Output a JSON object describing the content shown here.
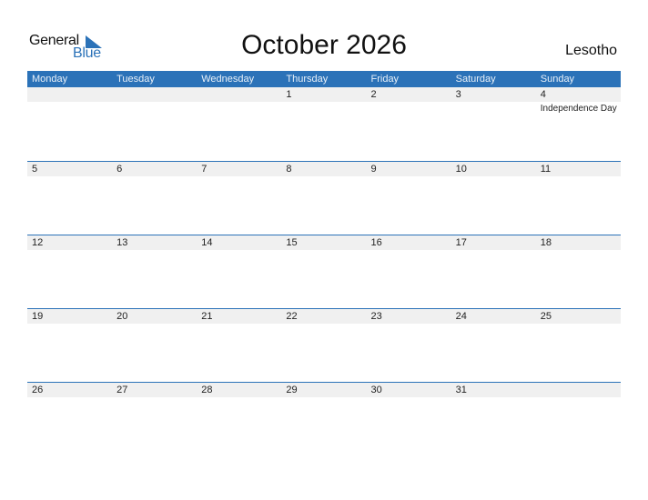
{
  "logo": {
    "line1": "General",
    "line2": "Blue",
    "icon": "triangle-flag-icon"
  },
  "title": "October 2026",
  "country": "Lesotho",
  "weekdays": [
    "Monday",
    "Tuesday",
    "Wednesday",
    "Thursday",
    "Friday",
    "Saturday",
    "Sunday"
  ],
  "weeks": [
    {
      "days": [
        "",
        "",
        "",
        "1",
        "2",
        "3",
        "4"
      ],
      "events": [
        "",
        "",
        "",
        "",
        "",
        "",
        "Independence Day"
      ]
    },
    {
      "days": [
        "5",
        "6",
        "7",
        "8",
        "9",
        "10",
        "11"
      ],
      "events": [
        "",
        "",
        "",
        "",
        "",
        "",
        ""
      ]
    },
    {
      "days": [
        "12",
        "13",
        "14",
        "15",
        "16",
        "17",
        "18"
      ],
      "events": [
        "",
        "",
        "",
        "",
        "",
        "",
        ""
      ]
    },
    {
      "days": [
        "19",
        "20",
        "21",
        "22",
        "23",
        "24",
        "25"
      ],
      "events": [
        "",
        "",
        "",
        "",
        "",
        "",
        ""
      ]
    },
    {
      "days": [
        "26",
        "27",
        "28",
        "29",
        "30",
        "31",
        ""
      ],
      "events": [
        "",
        "",
        "",
        "",
        "",
        "",
        ""
      ]
    }
  ],
  "colors": {
    "accent": "#2b72b8",
    "strip": "#f0f0f0"
  }
}
